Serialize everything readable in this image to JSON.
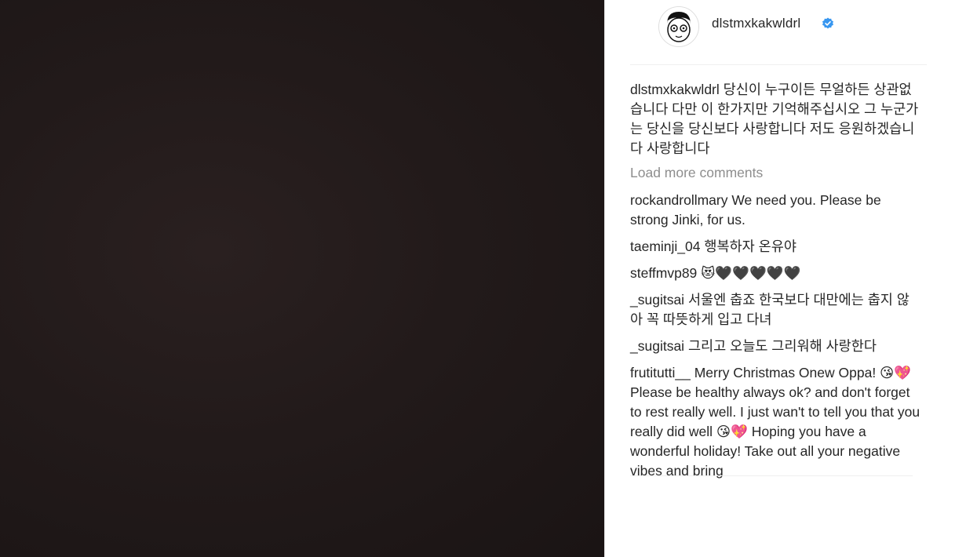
{
  "post": {
    "username": "dlstmxkakwldrl",
    "verified_icon": "verified-badge-icon",
    "caption_user": "dlstmxkakwldrl",
    "caption_text": "당신이 누구이든 무얼하든 상관없습니다 다만 이 한가지만 기억해주십시오 그 누군가는 당신을 당신보다 사랑합니다 저도 응원하겠습니다 사랑합니다",
    "load_more": "Load more comments"
  },
  "comments": [
    {
      "user": "rockandrollmary",
      "text": "We need you. Please be strong Jinki, for us."
    },
    {
      "user": "taeminji_04",
      "text": "행복하자 온유야"
    },
    {
      "user": "steffmvp89",
      "text": "😻🖤🖤🖤🖤🖤"
    },
    {
      "user": "_sugitsai",
      "text": "서울엔 춥죠 한국보다 대만에는 춥지 않아 꼭 따뜻하게 입고 다녀"
    },
    {
      "user": "_sugitsai",
      "text": "그리고 오늘도 그리워해 사랑한다"
    },
    {
      "user": "frutitutti__",
      "text": "Merry Christmas Onew Oppa! 😘💖 Please be healthy always ok? and don't forget to rest really well. I just wan't to tell you that you really did well 😘💖 Hoping you have a wonderful holiday! Take out all your negative vibes and bring"
    }
  ],
  "colors": {
    "accent_verified": "#3897f0",
    "muted": "#8e8e8e",
    "text": "#262626"
  }
}
